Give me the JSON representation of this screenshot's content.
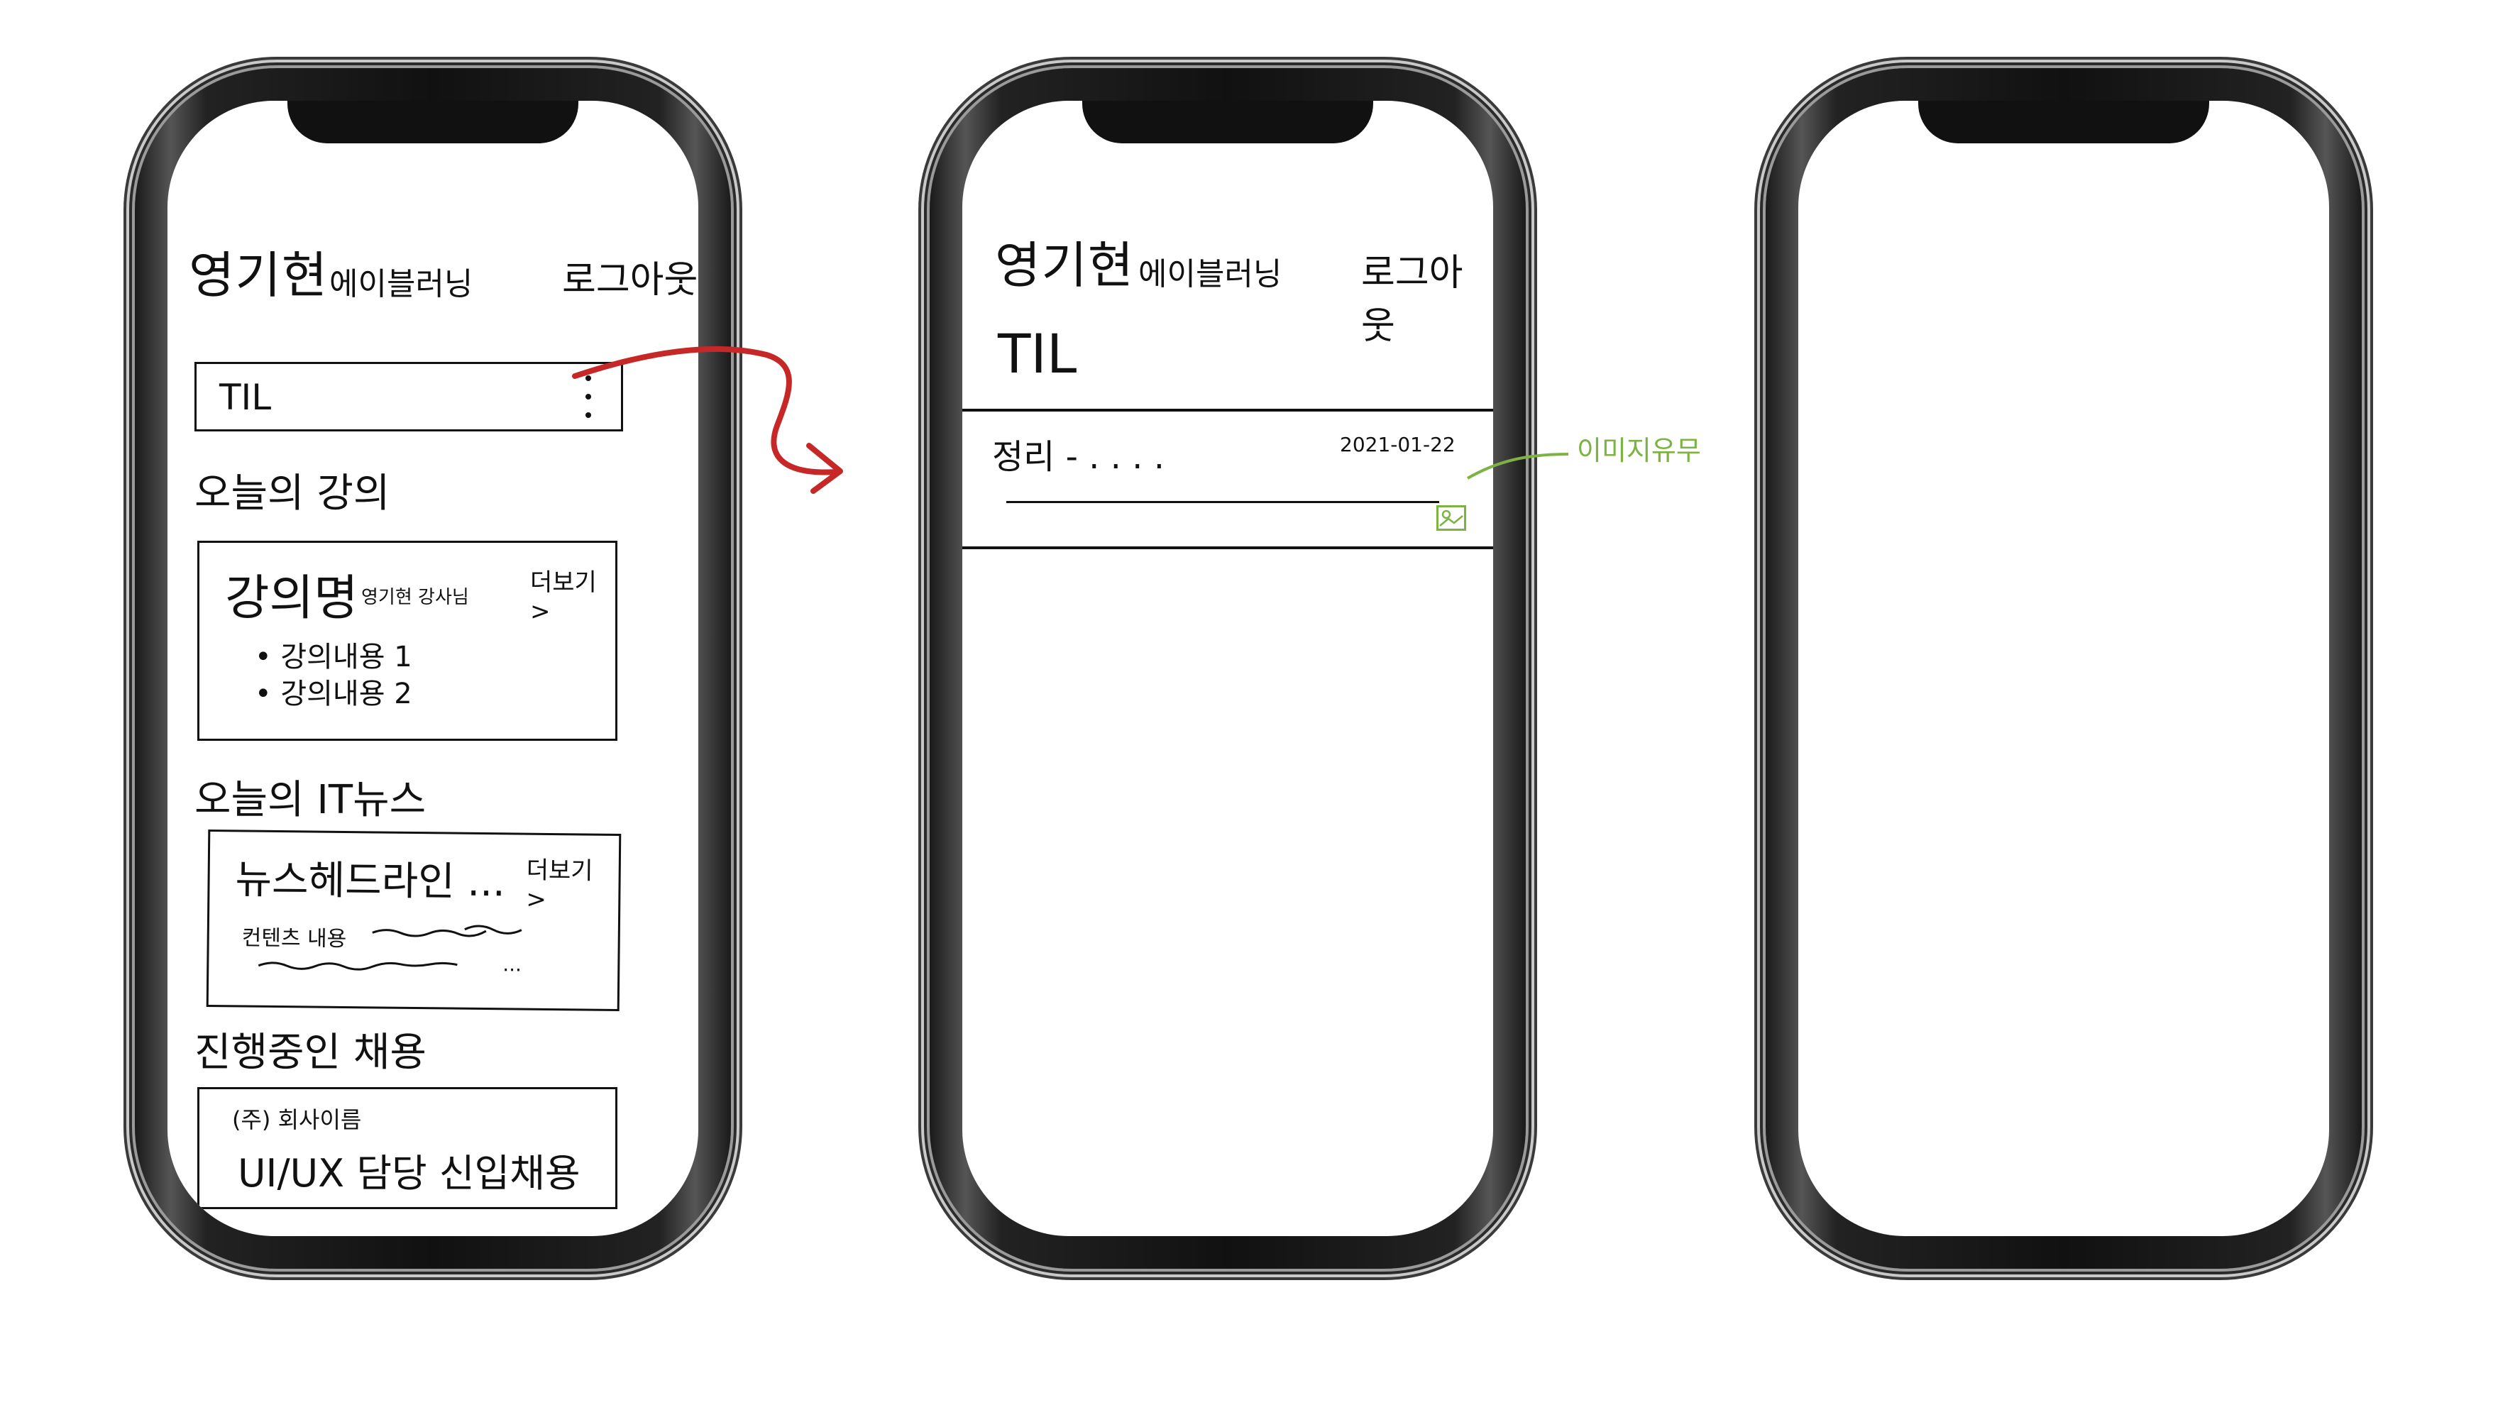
{
  "phone1": {
    "header": {
      "title": "영기현",
      "subtitle": "에이블러닝",
      "logout": "로그아웃"
    },
    "til": {
      "label": "TIL",
      "menu_icon": "kebab-icon"
    },
    "lecture_section": {
      "title": "오늘의 강의",
      "card": {
        "name": "강의명",
        "instructor": "영기현 강사님",
        "more": "더보기 >",
        "items": [
          "강의내용 1",
          "강의내용 2"
        ]
      }
    },
    "news_section": {
      "title": "오늘의 IT뉴스",
      "card": {
        "headline": "뉴스헤드라인 ...",
        "more": "더보기 >",
        "preview": "컨텐츠 내용",
        "ellipsis": "..."
      }
    },
    "jobs_section": {
      "title": "진행중인 채용",
      "card": {
        "company": "(주) 회사이름",
        "position": "UI/UX 담당 신입채용"
      }
    }
  },
  "phone2": {
    "header": {
      "title": "영기현",
      "subtitle": "에이블러닝",
      "logout": "로그아웃"
    },
    "page_title": "TIL",
    "entry": {
      "title": "정리 - . . . .",
      "date": "2021-01-22"
    }
  },
  "annotation": {
    "image_note": "이미지유무",
    "note_color": "#7cb342",
    "arrow_color": "#c62828"
  }
}
